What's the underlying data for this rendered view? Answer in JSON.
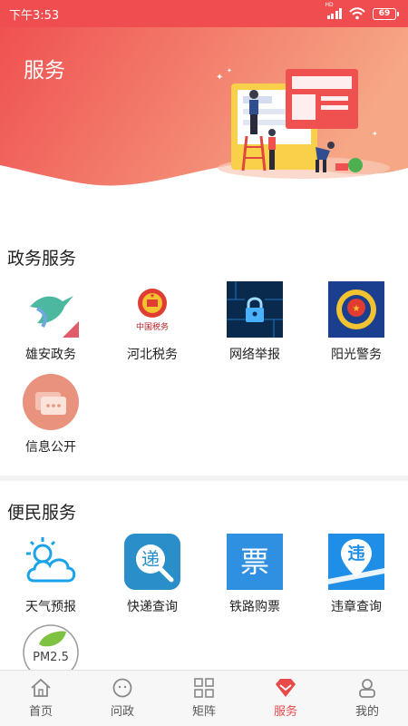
{
  "status_bar": {
    "time": "下午3:53",
    "network": "HD",
    "battery": "69"
  },
  "header": {
    "title": "服务"
  },
  "sections": [
    {
      "title": "政务服务",
      "items": [
        {
          "label": "雄安政务",
          "icon": "xiongan-bird-icon"
        },
        {
          "label": "河北税务",
          "icon": "national-emblem-tax-icon",
          "emblem_caption": "中国税务"
        },
        {
          "label": "网络举报",
          "icon": "cyber-lock-icon"
        },
        {
          "label": "阳光警务",
          "icon": "police-badge-icon"
        },
        {
          "label": "信息公开",
          "icon": "chat-bubbles-icon"
        }
      ]
    },
    {
      "title": "便民服务",
      "items": [
        {
          "label": "天气预报",
          "icon": "weather-sun-cloud-icon"
        },
        {
          "label": "快递查询",
          "icon": "express-search-icon",
          "glyph": "递"
        },
        {
          "label": "铁路购票",
          "icon": "railway-ticket-icon",
          "glyph": "票"
        },
        {
          "label": "违章查询",
          "icon": "traffic-violation-icon",
          "glyph": "违"
        },
        {
          "label": "",
          "icon": "pm25-leaf-icon",
          "glyph": "PM2.5"
        }
      ]
    }
  ],
  "tabbar": {
    "items": [
      {
        "label": "首页",
        "icon": "home-icon",
        "active": false
      },
      {
        "label": "问政",
        "icon": "chat-face-icon",
        "active": false
      },
      {
        "label": "矩阵",
        "icon": "grid-icon",
        "active": false
      },
      {
        "label": "服务",
        "icon": "diamond-service-icon",
        "active": true
      },
      {
        "label": "我的",
        "icon": "profile-icon",
        "active": false
      }
    ]
  },
  "colors": {
    "accent": "#ef4d4f",
    "active_tab": "#e84a4a",
    "banner_end": "#f6a785"
  }
}
